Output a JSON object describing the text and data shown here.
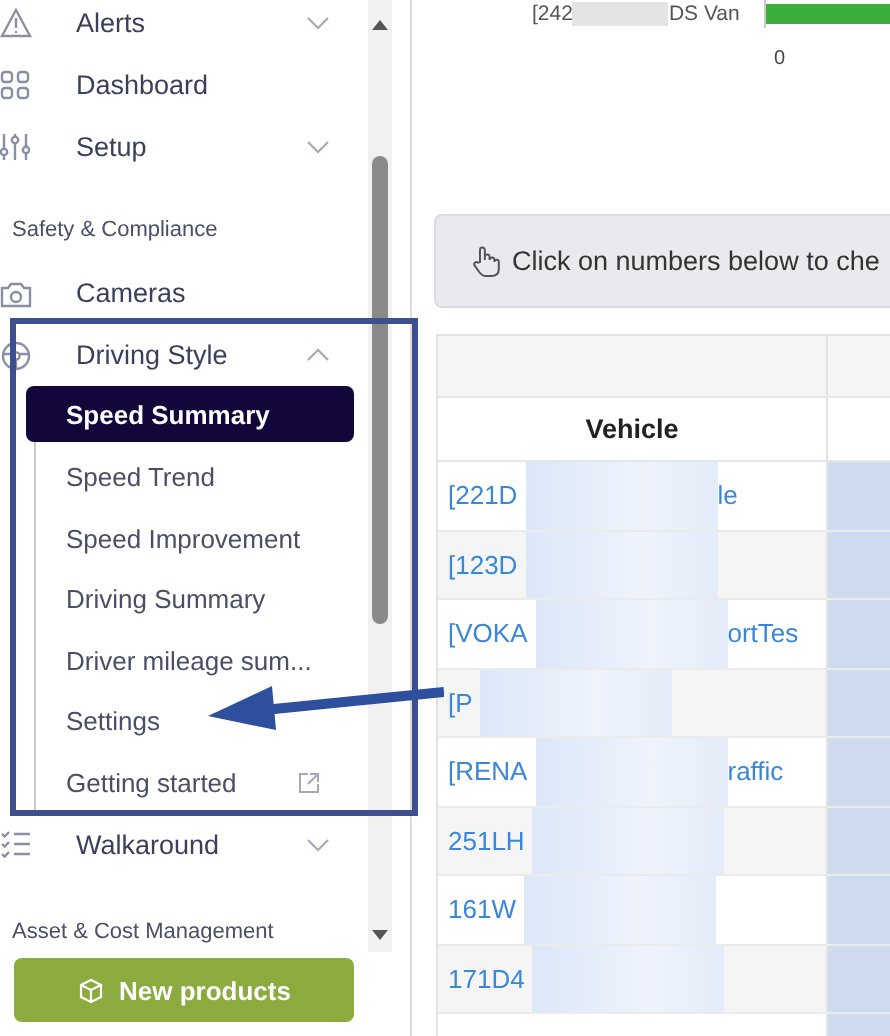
{
  "sidebar": {
    "nav": [
      {
        "kind": "item",
        "label": "Alerts",
        "expanded": false
      },
      {
        "kind": "item",
        "label": "Dashboard"
      },
      {
        "kind": "item",
        "label": "Setup",
        "expanded": false
      },
      {
        "kind": "section",
        "label": "Safety & Compliance"
      },
      {
        "kind": "item",
        "label": "Cameras"
      },
      {
        "kind": "group",
        "label": "Driving Style",
        "expanded": true,
        "children": [
          {
            "label": "Speed Summary",
            "selected": true
          },
          {
            "label": "Speed Trend",
            "selected": false
          },
          {
            "label": "Speed Improvement",
            "selected": false
          },
          {
            "label": "Driving Summary",
            "selected": false
          },
          {
            "label": "Driver mileage sum...",
            "selected": false
          },
          {
            "label": "Settings",
            "selected": false
          },
          {
            "label": "Getting started",
            "selected": false,
            "external": true
          }
        ]
      },
      {
        "kind": "item",
        "label": "Walkaround",
        "expanded": false
      },
      {
        "kind": "section",
        "label": "Asset & Cost Management"
      }
    ],
    "button": "New products"
  },
  "chart": {
    "label_start": "[242",
    "label_end": "DS Van",
    "tick": "0"
  },
  "banner": "Click on numbers below to che",
  "table": {
    "columns": [
      "Vehicle"
    ],
    "rows": [
      {
        "parts": [
          "[221D",
          "le"
        ]
      },
      {
        "parts": [
          "[123D"
        ]
      },
      {
        "parts": [
          "[VOKA",
          "ortTes"
        ]
      },
      {
        "parts": [
          "[P"
        ]
      },
      {
        "parts": [
          "[RENA",
          "raffic"
        ]
      },
      {
        "parts": [
          "251LH"
        ]
      },
      {
        "parts": [
          "161W"
        ]
      },
      {
        "parts": [
          "171D4"
        ]
      },
      {
        "parts": []
      }
    ]
  }
}
